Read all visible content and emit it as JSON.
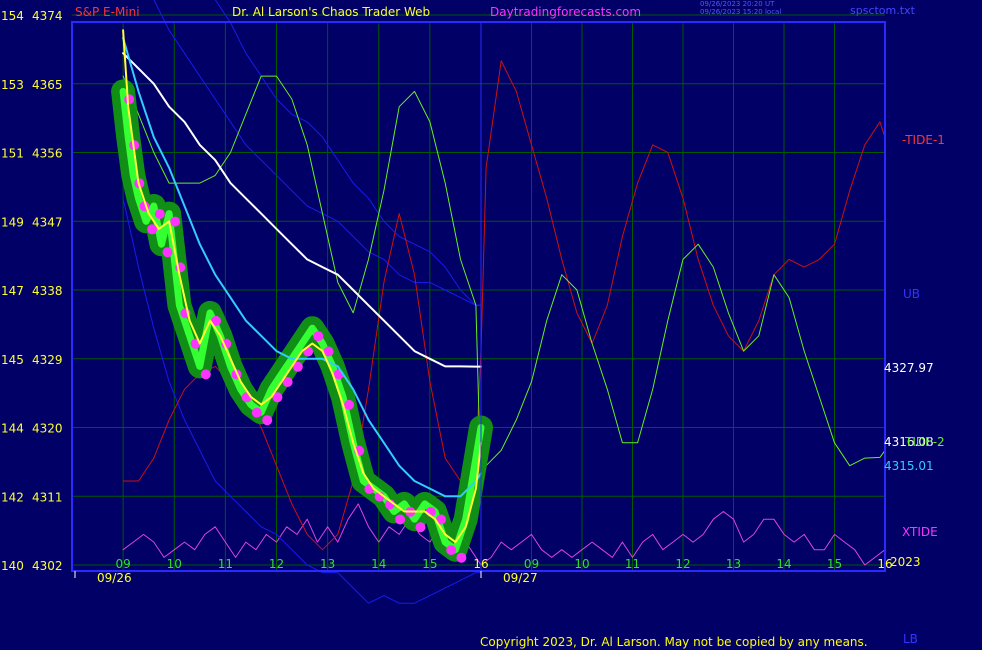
{
  "header": {
    "symbol": "S&P E-Mini",
    "site_title": "Dr. Al Larson's Chaos Trader Web",
    "site_url": "Daytradingforecasts.com",
    "stamp_line1": "09/26/2023 20:20 UT",
    "stamp_line2": "09/26/2023 15:20 local",
    "corner_text": "spsctom.txt"
  },
  "copyright": "Copyright 2023, Dr. Al Larson. May not be copied by any means.",
  "colors": {
    "background": "#000066",
    "grid": "#005a00",
    "plot_border": "#2a2aff",
    "green_band": "#129612",
    "bright_green": "#33ff33",
    "magenta": "#ff33ff",
    "yellow": "#ffff33",
    "cyan": "#33ccff",
    "white": "#ffffff",
    "red": "#cc1111",
    "lime": "#66ee22",
    "blue": "#1a1aee",
    "pink": "#dd44dd"
  },
  "chart_data": {
    "type": "line",
    "title": "S&P E-Mini",
    "ylim": [
      4302,
      4374
    ],
    "y_ticks": [
      {
        "left": "154",
        "right": "4374",
        "value": 4374
      },
      {
        "left": "153",
        "right": "4365",
        "value": 4365
      },
      {
        "left": "151",
        "right": "4356",
        "value": 4356
      },
      {
        "left": "149",
        "right": "4347",
        "value": 4347
      },
      {
        "left": "147",
        "right": "4338",
        "value": 4338
      },
      {
        "left": "145",
        "right": "4329",
        "value": 4329
      },
      {
        "left": "144",
        "right": "4320",
        "value": 4320
      },
      {
        "left": "142",
        "right": "4311",
        "value": 4311
      },
      {
        "left": "140",
        "right": "4302",
        "value": 4302
      }
    ],
    "x_ticks": [
      "09",
      "10",
      "11",
      "12",
      "13",
      "14",
      "15",
      "16",
      "09",
      "10",
      "11",
      "12",
      "13",
      "14",
      "15",
      "16"
    ],
    "date_labels": [
      "09/26",
      "09/27"
    ],
    "year_label": "2023",
    "right_labels": {
      "tide1": "-TIDE-1",
      "ub": "UB",
      "tide2": "TIDE-2",
      "xtide": "XTIDE",
      "lb": "LB",
      "value_white": "4327.97",
      "value_cyan": "4315.01",
      "value_overlap": "4316.08"
    },
    "series": [
      {
        "key": "price",
        "x": [
          9.0,
          9.1,
          9.2,
          9.3,
          9.45,
          9.6,
          9.75,
          9.9,
          10.0,
          10.1,
          10.3,
          10.5,
          10.7,
          10.9,
          11.1,
          11.3,
          11.5,
          11.7,
          11.9,
          12.1,
          12.3,
          12.5,
          12.7,
          12.9,
          13.1,
          13.3,
          13.5,
          13.7,
          13.9,
          14.1,
          14.3,
          14.5,
          14.7,
          14.9,
          15.1,
          15.3,
          15.5,
          15.7,
          15.8,
          15.9,
          16.0
        ],
        "y": [
          4364,
          4358,
          4353,
          4350,
          4347,
          4349,
          4344,
          4348,
          4342,
          4336,
          4332,
          4328,
          4335,
          4332,
          4328,
          4325,
          4323,
          4322,
          4325,
          4327,
          4329,
          4331,
          4333,
          4331,
          4328,
          4324,
          4318,
          4313,
          4312,
          4311,
          4309,
          4310,
          4308,
          4310,
          4309,
          4305,
          4304,
          4308,
          4312,
          4316,
          4320
        ]
      },
      {
        "key": "ma_yellow",
        "x": [
          9.0,
          9.1,
          9.3,
          9.5,
          9.7,
          9.9,
          10.1,
          10.3,
          10.5,
          10.7,
          10.9,
          11.1,
          11.3,
          11.5,
          11.7,
          11.9,
          12.1,
          12.3,
          12.5,
          12.7,
          12.9,
          13.1,
          13.3,
          13.5,
          13.7,
          13.9,
          14.1,
          14.3,
          14.5,
          14.7,
          14.9,
          15.1,
          15.3,
          15.5,
          15.7,
          15.9,
          16.0
        ],
        "y": [
          4372,
          4362,
          4352,
          4348,
          4346,
          4347,
          4340,
          4334,
          4331,
          4334,
          4332,
          4329,
          4326,
          4324,
          4323,
          4324,
          4326,
          4328,
          4330,
          4331,
          4330,
          4327,
          4323,
          4318,
          4314,
          4312,
          4311,
          4310,
          4309,
          4309,
          4309,
          4308,
          4306,
          4305,
          4307,
          4312,
          4318
        ]
      },
      {
        "key": "ma_cyan",
        "x": [
          9.0,
          9.3,
          9.6,
          9.9,
          10.2,
          10.5,
          10.8,
          11.1,
          11.4,
          11.7,
          12.0,
          12.3,
          12.6,
          12.9,
          13.2,
          13.5,
          13.8,
          14.1,
          14.4,
          14.7,
          15.0,
          15.3,
          15.6,
          15.9,
          16.0
        ],
        "y": [
          4371,
          4364,
          4358,
          4354,
          4349,
          4344,
          4340,
          4337,
          4334,
          4332,
          4330,
          4329,
          4329,
          4329,
          4328,
          4325,
          4321,
          4318,
          4315,
          4313,
          4312,
          4311,
          4311,
          4313,
          4314
        ]
      },
      {
        "key": "ma_white",
        "x": [
          9.0,
          9.3,
          9.6,
          9.9,
          10.2,
          10.5,
          10.8,
          11.1,
          11.4,
          11.7,
          12.0,
          12.3,
          12.6,
          12.9,
          13.2,
          13.5,
          13.8,
          14.1,
          14.4,
          14.7,
          15.0,
          15.3,
          15.6,
          15.9,
          16.0
        ],
        "y": [
          4369,
          4367,
          4365,
          4362,
          4360,
          4357,
          4355,
          4352,
          4350,
          4348,
          4346,
          4344,
          4342,
          4341,
          4340,
          4338,
          4336,
          4334,
          4332,
          4330,
          4329,
          4328,
          4328,
          4327.97,
          4327.97
        ]
      },
      {
        "key": "tide1_red",
        "x": [
          9.0,
          9.3,
          9.6,
          9.9,
          10.2,
          10.5,
          10.8,
          11.1,
          11.4,
          11.7,
          12.0,
          12.3,
          12.6,
          12.9,
          13.2,
          13.5,
          13.8,
          14.1,
          14.4,
          14.7,
          15.0,
          15.3,
          15.6,
          15.9,
          16.0,
          16.1,
          16.4,
          16.7,
          17.0,
          17.3,
          17.6,
          17.9,
          18.2,
          18.5,
          18.8,
          19.1,
          19.4,
          19.7,
          20.0,
          20.3,
          20.6,
          20.9,
          21.2,
          21.5,
          21.8,
          22.1,
          22.4,
          22.7,
          23.0,
          23.3,
          23.6,
          23.9,
          24.0
        ],
        "y": [
          4313,
          4313,
          4316,
          4321,
          4325,
          4327,
          4328,
          4326,
          4324,
          4320,
          4315,
          4310,
          4306,
          4304,
          4306,
          4313,
          4325,
          4339,
          4348,
          4340,
          4326,
          4316,
          4313,
          4316,
          4330,
          4354,
          4368,
          4364,
          4357,
          4350,
          4342,
          4335,
          4331,
          4336,
          4345,
          4352,
          4357,
          4356,
          4350,
          4342,
          4336,
          4332,
          4330,
          4334,
          4340,
          4342,
          4341,
          4342,
          4344,
          4351,
          4357,
          4360,
          4358
        ]
      },
      {
        "key": "tide2_lime",
        "x": [
          9.0,
          9.3,
          9.6,
          9.9,
          10.2,
          10.5,
          10.8,
          11.1,
          11.4,
          11.7,
          12.0,
          12.3,
          12.6,
          12.9,
          13.2,
          13.5,
          13.8,
          14.1,
          14.4,
          14.7,
          15.0,
          15.3,
          15.6,
          15.9,
          16.0,
          16.1,
          16.4,
          16.7,
          17.0,
          17.3,
          17.6,
          17.9,
          18.2,
          18.5,
          18.8,
          19.1,
          19.4,
          19.7,
          20.0,
          20.3,
          20.6,
          20.9,
          21.2,
          21.5,
          21.8,
          22.1,
          22.4,
          22.7,
          23.0,
          23.3,
          23.6,
          23.9,
          24.0
        ],
        "y": [
          4366,
          4361,
          4356,
          4352,
          4352,
          4352,
          4353,
          4356,
          4361,
          4366,
          4366,
          4363,
          4357,
          4348,
          4339,
          4335,
          4342,
          4351,
          4362,
          4364,
          4360,
          4352,
          4342,
          4336,
          4312,
          4315,
          4317,
          4321,
          4326,
          4334,
          4340,
          4338,
          4331,
          4325,
          4318,
          4318,
          4325,
          4334,
          4342,
          4344,
          4341,
          4335,
          4330,
          4332,
          4340,
          4337,
          4330,
          4324,
          4318,
          4315,
          4316,
          4316.08,
          4317
        ]
      },
      {
        "key": "ub_blue",
        "x": [
          9.0,
          9.3,
          9.6,
          9.9,
          10.2,
          10.5,
          10.8,
          11.1,
          11.4,
          11.7,
          12.0,
          12.3,
          12.6,
          12.9,
          13.2,
          13.5,
          13.8,
          14.1,
          14.4,
          14.7,
          15.0,
          15.3,
          15.6,
          15.9,
          16.0
        ],
        "y": [
          4393,
          4391,
          4388,
          4385,
          4382,
          4379,
          4376,
          4373,
          4369,
          4366,
          4363,
          4361,
          4360,
          4358,
          4355,
          4352,
          4350,
          4347,
          4345,
          4344,
          4343,
          4341,
          4338,
          4336,
          4336
        ]
      },
      {
        "key": "ub_blue2",
        "x": [
          9.0,
          9.3,
          9.6,
          9.9,
          10.2,
          10.5,
          10.8,
          11.1,
          11.4,
          11.7,
          12.0,
          12.3,
          12.6,
          12.9,
          13.2,
          13.5,
          13.8,
          14.1,
          14.4,
          14.7,
          15.0,
          15.3,
          15.6,
          15.9,
          16.0
        ],
        "y": [
          4384,
          4380,
          4376,
          4372,
          4369,
          4366,
          4363,
          4360,
          4357,
          4355,
          4353,
          4351,
          4349,
          4348,
          4347,
          4345,
          4343,
          4342,
          4340,
          4339,
          4339,
          4338,
          4337,
          4336,
          4336
        ]
      },
      {
        "key": "lb_blue",
        "x": [
          9.0,
          9.3,
          9.6,
          9.9,
          10.2,
          10.5,
          10.8,
          11.1,
          11.4,
          11.7,
          12.0,
          12.3,
          12.6,
          12.9,
          13.2,
          13.5,
          13.8,
          14.1,
          14.4,
          14.7,
          15.0,
          15.3,
          15.6,
          15.9,
          16.0
        ],
        "y": [
          4350,
          4341,
          4333,
          4326,
          4321,
          4317,
          4313,
          4311,
          4309,
          4307,
          4306,
          4304,
          4302,
          4301,
          4301,
          4299,
          4297,
          4298,
          4297,
          4297,
          4298,
          4299,
          4300,
          4301,
          4301
        ]
      },
      {
        "key": "xtide_pink",
        "x": [
          9.0,
          9.2,
          9.4,
          9.6,
          9.8,
          10.0,
          10.2,
          10.4,
          10.6,
          10.8,
          11.0,
          11.2,
          11.4,
          11.6,
          11.8,
          12.0,
          12.2,
          12.4,
          12.6,
          12.8,
          13.0,
          13.2,
          13.4,
          13.6,
          13.8,
          14.0,
          14.2,
          14.4,
          14.6,
          14.8,
          15.0,
          15.2,
          15.4,
          15.6,
          15.8,
          16.0,
          16.2,
          16.4,
          16.6,
          16.8,
          17.0,
          17.2,
          17.4,
          17.6,
          17.8,
          18.0,
          18.2,
          18.4,
          18.6,
          18.8,
          19.0,
          19.2,
          19.4,
          19.6,
          19.8,
          20.0,
          20.2,
          20.4,
          20.6,
          20.8,
          21.0,
          21.2,
          21.4,
          21.6,
          21.8,
          22.0,
          22.2,
          22.4,
          22.6,
          22.8,
          23.0,
          23.2,
          23.4,
          23.6,
          23.8,
          24.0
        ],
        "y": [
          4304,
          4305,
          4306,
          4305,
          4303,
          4304,
          4305,
          4304,
          4306,
          4307,
          4305,
          4303,
          4305,
          4304,
          4306,
          4305,
          4307,
          4306,
          4308,
          4305,
          4307,
          4305,
          4308,
          4310,
          4307,
          4305,
          4307,
          4306,
          4308,
          4306,
          4305,
          4307,
          4305,
          4306,
          4304,
          4302,
          4303,
          4305,
          4304,
          4305,
          4306,
          4304,
          4303,
          4304,
          4303,
          4304,
          4305,
          4304,
          4303,
          4305,
          4303,
          4305,
          4306,
          4304,
          4305,
          4306,
          4305,
          4306,
          4308,
          4309,
          4308,
          4305,
          4306,
          4308,
          4308,
          4306,
          4305,
          4306,
          4304,
          4304,
          4306,
          4305,
          4304,
          4302,
          4303,
          4304
        ]
      }
    ]
  }
}
